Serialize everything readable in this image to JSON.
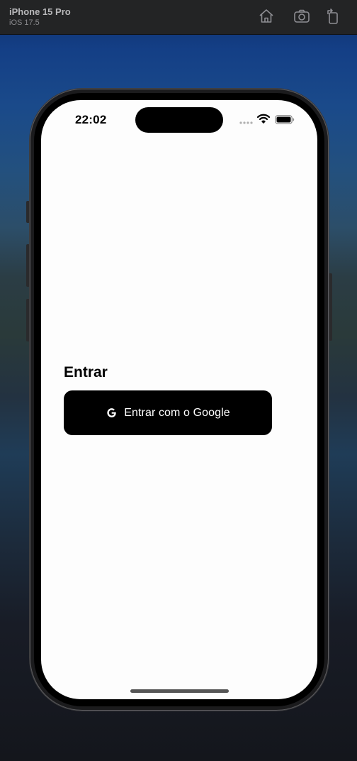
{
  "simulator": {
    "device_name": "iPhone 15 Pro",
    "os_version": "iOS 17.5",
    "toolbar_icons": [
      "home-icon",
      "screenshot-icon",
      "rotate-icon"
    ]
  },
  "status_bar": {
    "time": "22:02",
    "icons": [
      "signal-dots-icon",
      "wifi-icon",
      "battery-icon"
    ]
  },
  "login": {
    "title": "Entrar",
    "google_button_label": "Entrar com o Google",
    "google_icon": "google-g-icon"
  },
  "colors": {
    "screen_background": "#fdfdfd",
    "button_background": "#000000",
    "button_text": "#ffffff"
  }
}
